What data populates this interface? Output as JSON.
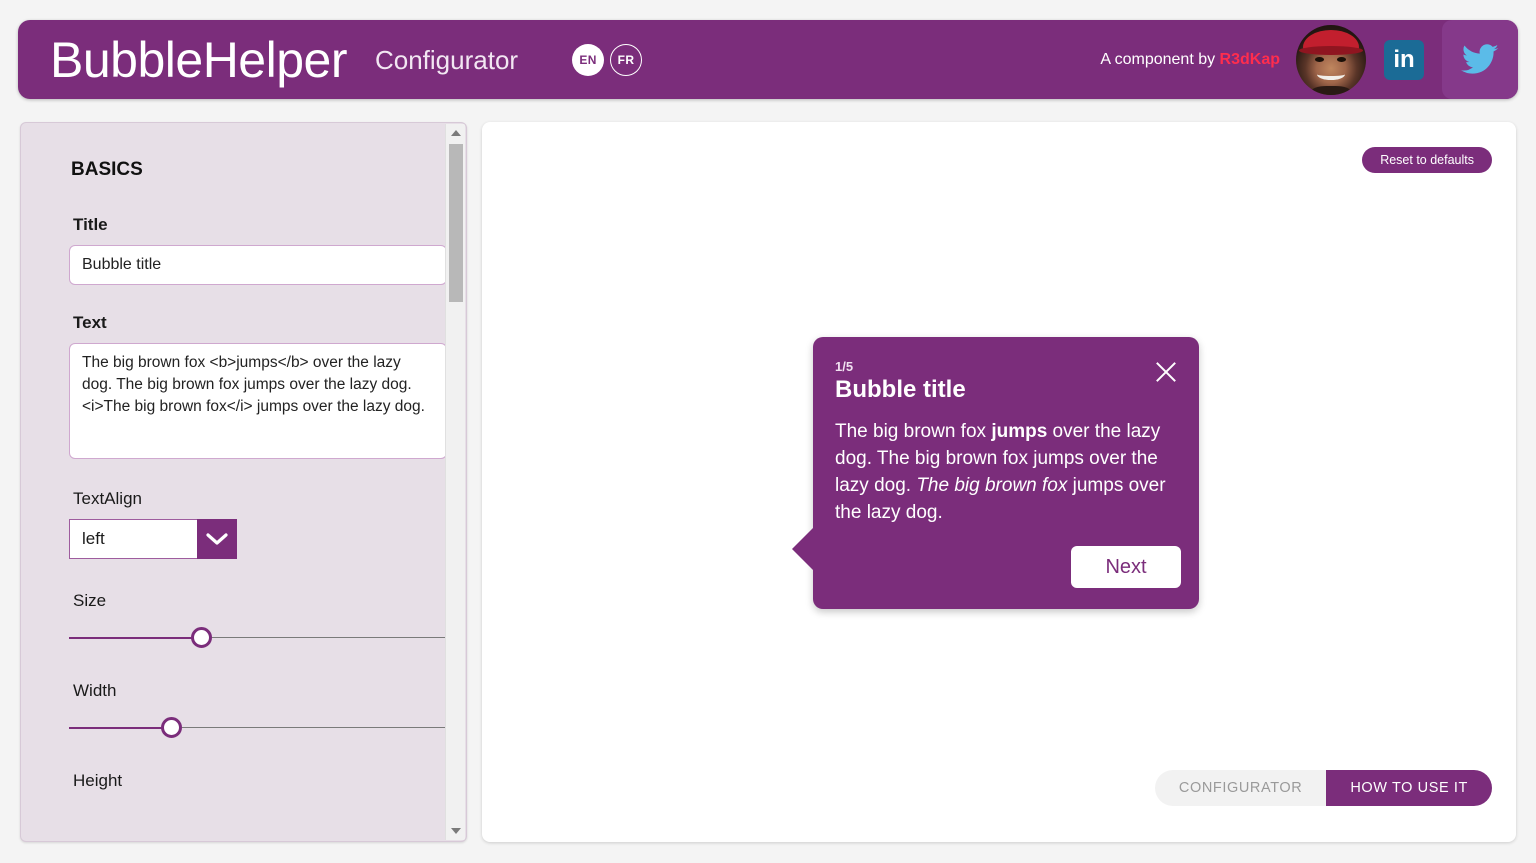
{
  "header": {
    "brand": "BubbleHelper",
    "subtitle": "Configurator",
    "languages": [
      {
        "code": "EN",
        "active": true
      },
      {
        "code": "FR",
        "active": false
      }
    ],
    "credit_prefix": "A component by ",
    "credit_handle": "R3dKap",
    "avatar_name": "avatar",
    "linkedin_label": "in",
    "brand_color": "#7b2d7b",
    "handle_color": "#ff2d4d"
  },
  "sidebar": {
    "section_title": "BASICS",
    "fields": {
      "title": {
        "label": "Title",
        "value": "Bubble title"
      },
      "text": {
        "label": "Text",
        "value": "The big brown fox <b>jumps</b> over the lazy dog. The big brown fox jumps over the lazy dog. <i>The big brown fox</i> jumps over the lazy dog."
      },
      "textalign": {
        "label": "TextAlign",
        "value": "left"
      },
      "size": {
        "label": "Size",
        "percent": 35
      },
      "width": {
        "label": "Width",
        "percent": 27
      },
      "height": {
        "label": "Height"
      }
    }
  },
  "main": {
    "reset_label": "Reset to defaults",
    "bubble": {
      "counter": "1/5",
      "title": "Bubble title",
      "text_plain": "The big brown fox jumps over the lazy dog. The big brown fox jumps over the lazy dog. The big brown fox jumps over the lazy dog.",
      "text_parts": [
        {
          "text": "The big brown fox ",
          "style": "normal"
        },
        {
          "text": "jumps",
          "style": "bold"
        },
        {
          "text": " over the lazy dog. The big brown fox jumps over the lazy dog. ",
          "style": "normal"
        },
        {
          "text": "The big brown fox",
          "style": "italic"
        },
        {
          "text": " jumps over the lazy dog.",
          "style": "normal"
        }
      ],
      "next_label": "Next",
      "close_label": "close"
    },
    "tabs": [
      {
        "label": "CONFIGURATOR",
        "active": false
      },
      {
        "label": "HOW TO USE IT",
        "active": true
      }
    ]
  }
}
